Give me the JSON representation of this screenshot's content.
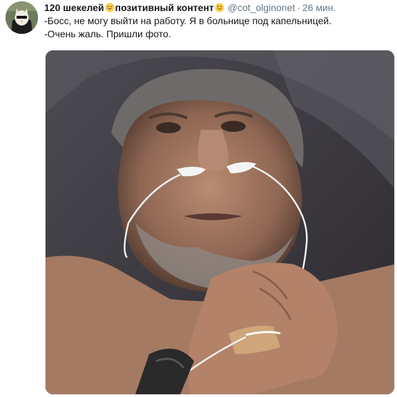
{
  "tweet": {
    "display_name": "120 шекелей",
    "display_name_suffix": "позитивный контент",
    "emoji_1": "grinning-face-with-sweat-emoji",
    "emoji_2": "smiling-face-emoji",
    "handle": "@cot_olginonet",
    "separator": "·",
    "time": "26 мин.",
    "lines": [
      "-Босс, не могу выйти на работу. Я в больнице под капельницей.",
      "-Очень жаль. Пришли фото."
    ],
    "avatar_icon": "cat-avatar-icon",
    "media_description_icon": "photo-man-in-hospital-bed-with-earphones-icon"
  },
  "colors": {
    "text": "#14171a",
    "secondary": "#657786",
    "border": "#e1e8ed",
    "emoji_yellow": "#ffcc4d"
  }
}
